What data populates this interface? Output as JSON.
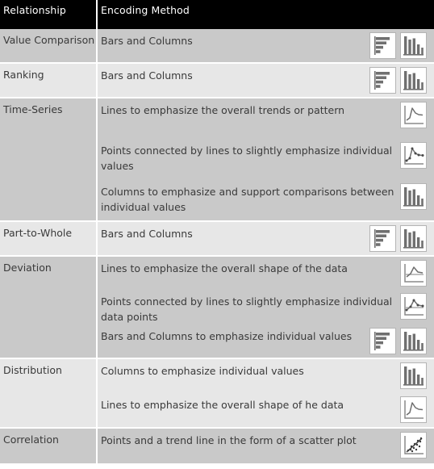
{
  "table": {
    "columns": [
      {
        "key": "relationship",
        "label": "Relationship"
      },
      {
        "key": "encoding",
        "label": "Encoding Method"
      }
    ],
    "colors": {
      "header_background": "#000000",
      "header_text": "#ffffff",
      "row_shade_dark": "#c9c9c9",
      "row_shade_light": "#e7e7e7",
      "body_text": "#3a3a3a",
      "icon_background": "#ffffff",
      "icon_border": "#b4b4b4",
      "icon_fill": "#707070",
      "page_background": "#ffffff"
    },
    "rows": [
      {
        "relationship": "Value Comparison",
        "shade": "dark",
        "entries": [
          {
            "text": "Bars and Columns",
            "icons": [
              "horizontal-bar-chart-icon",
              "column-chart-icon"
            ]
          }
        ]
      },
      {
        "relationship": "Ranking",
        "shade": "light",
        "entries": [
          {
            "text": "Bars and Columns",
            "icons": [
              "horizontal-bar-chart-icon",
              "column-chart-icon"
            ]
          }
        ]
      },
      {
        "relationship": "Time-Series",
        "shade": "dark",
        "entries": [
          {
            "text": "Lines to emphasize the overall trends or pattern",
            "icons": [
              "line-chart-icon"
            ]
          },
          {
            "text": "Points connected by lines to slightly emphasize individual values",
            "icons": [
              "line-chart-with-points-icon"
            ]
          },
          {
            "text": "Columns to emphasize and support comparisons between individual values",
            "icons": [
              "column-chart-icon"
            ]
          }
        ]
      },
      {
        "relationship": "Part-to-Whole",
        "shade": "light",
        "entries": [
          {
            "text": "Bars and Columns",
            "icons": [
              "horizontal-bar-chart-icon",
              "column-chart-icon"
            ]
          }
        ]
      },
      {
        "relationship": "Deviation",
        "shade": "dark",
        "entries": [
          {
            "text": "Lines to emphasize the overall shape of the data",
            "icons": [
              "deviation-line-chart-icon"
            ]
          },
          {
            "text": "Points connected by lines to slightly emphasize individual data points",
            "icons": [
              "deviation-line-chart-with-points-icon"
            ]
          },
          {
            "text": "Bars and Columns to emphasize individual values",
            "icons": [
              "horizontal-bar-chart-icon",
              "column-chart-icon"
            ]
          }
        ]
      },
      {
        "relationship": "Distribution",
        "shade": "light",
        "entries": [
          {
            "text": "Columns to emphasize individual values",
            "icons": [
              "column-chart-icon"
            ]
          },
          {
            "text": "Lines to emphasize the overall shape of he data",
            "icons": [
              "line-chart-icon"
            ]
          }
        ]
      },
      {
        "relationship": "Correlation",
        "shade": "dark",
        "entries": [
          {
            "text": "Points and a trend line in the form of a scatter plot",
            "icons": [
              "scatter-plot-icon"
            ]
          }
        ]
      }
    ]
  }
}
